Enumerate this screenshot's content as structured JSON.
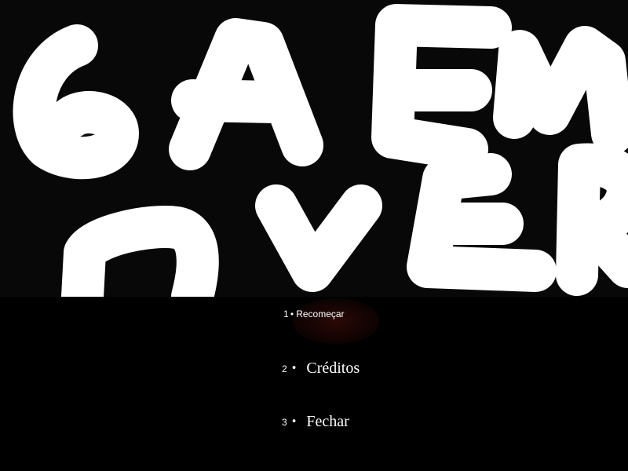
{
  "title_art": {
    "text": "GAME OVER",
    "line_1": "GAME",
    "line_2": "OVER"
  },
  "menu": {
    "items": [
      {
        "number": "1",
        "bullet": "•",
        "label": "Recomeçar",
        "highlighted": true
      },
      {
        "number": "2",
        "bullet": "•",
        "label": "Créditos",
        "highlighted": false
      },
      {
        "number": "3",
        "bullet": "•",
        "label": "Fechar",
        "highlighted": false
      }
    ]
  },
  "colors": {
    "background": "#000000",
    "title_panel": "#080808",
    "title_strokes": "#ffffff",
    "menu_text": "#ffffff",
    "hover_glow": "#300a06"
  }
}
